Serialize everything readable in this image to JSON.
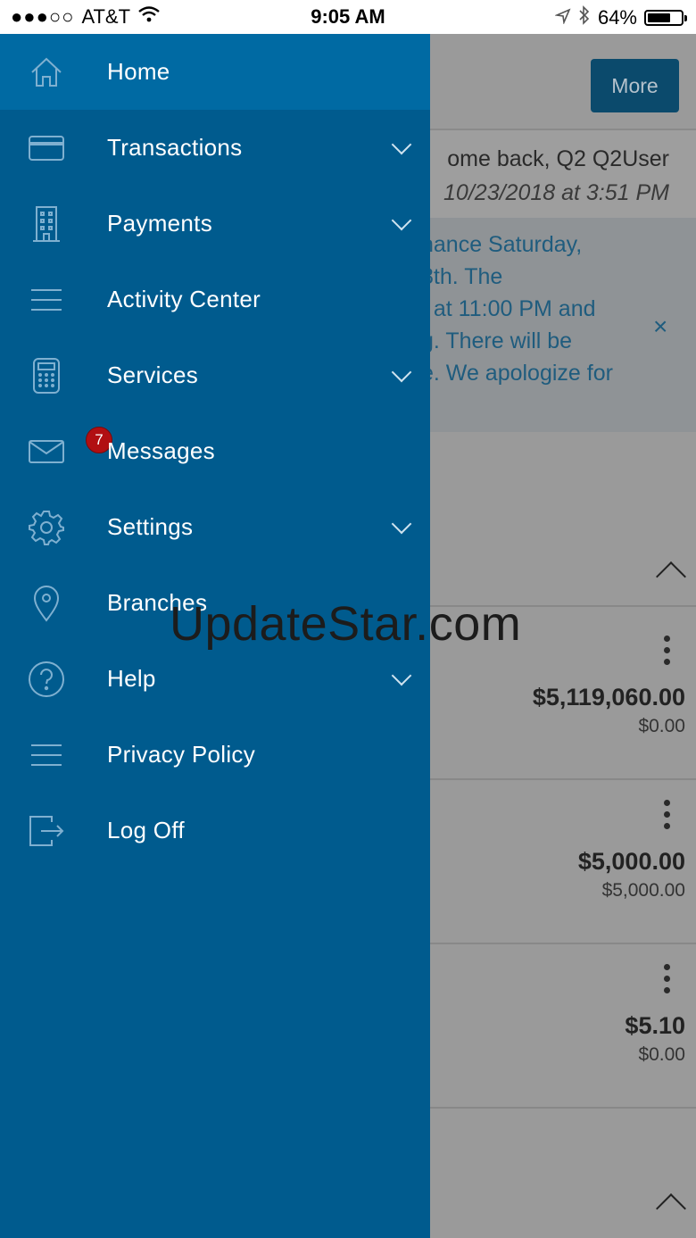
{
  "status_bar": {
    "signal": "●●●○○",
    "carrier": "AT&T",
    "time": "9:05 AM",
    "battery": "64%",
    "battery_level": 0.64
  },
  "background_page": {
    "more_label": "More",
    "welcome_line": "ome back, Q2 Q2User",
    "last_login": "10/23/2018 at 3:51 PM",
    "notice_lines": [
      "nance Saturday,",
      "8th. The",
      "t at 11:00 PM and",
      "g. There will be",
      "e. We apologize for"
    ],
    "close_symbol": "×",
    "accounts": [
      {
        "amount": "$5,119,060.00",
        "sub": "$0.00"
      },
      {
        "amount": "$5,000.00",
        "sub": "$5,000.00"
      },
      {
        "amount": "$5.10",
        "sub": "$0.00"
      }
    ]
  },
  "drawer": {
    "items": [
      {
        "label": "Home",
        "icon": "home-icon"
      },
      {
        "label": "Transactions",
        "icon": "card-icon",
        "expandable": true
      },
      {
        "label": "Payments",
        "icon": "building-icon",
        "expandable": true
      },
      {
        "label": "Activity Center",
        "icon": "list-icon"
      },
      {
        "label": "Services",
        "icon": "calculator-icon",
        "expandable": true
      },
      {
        "label": "Messages",
        "icon": "mail-icon",
        "badge": "7"
      },
      {
        "label": "Settings",
        "icon": "gear-icon",
        "expandable": true
      },
      {
        "label": "Branches",
        "icon": "map-pin-icon"
      },
      {
        "label": "Help",
        "icon": "help-icon",
        "expandable": true
      },
      {
        "label": "Privacy Policy",
        "icon": "list-icon"
      },
      {
        "label": "Log Off",
        "icon": "logout-icon"
      }
    ]
  },
  "watermark": "UpdateStar.com",
  "colors": {
    "drawer_bg": "#005b8e",
    "drawer_active": "#006aa3",
    "badge": "#b10f12",
    "accent_text": "#1f5c7e"
  }
}
